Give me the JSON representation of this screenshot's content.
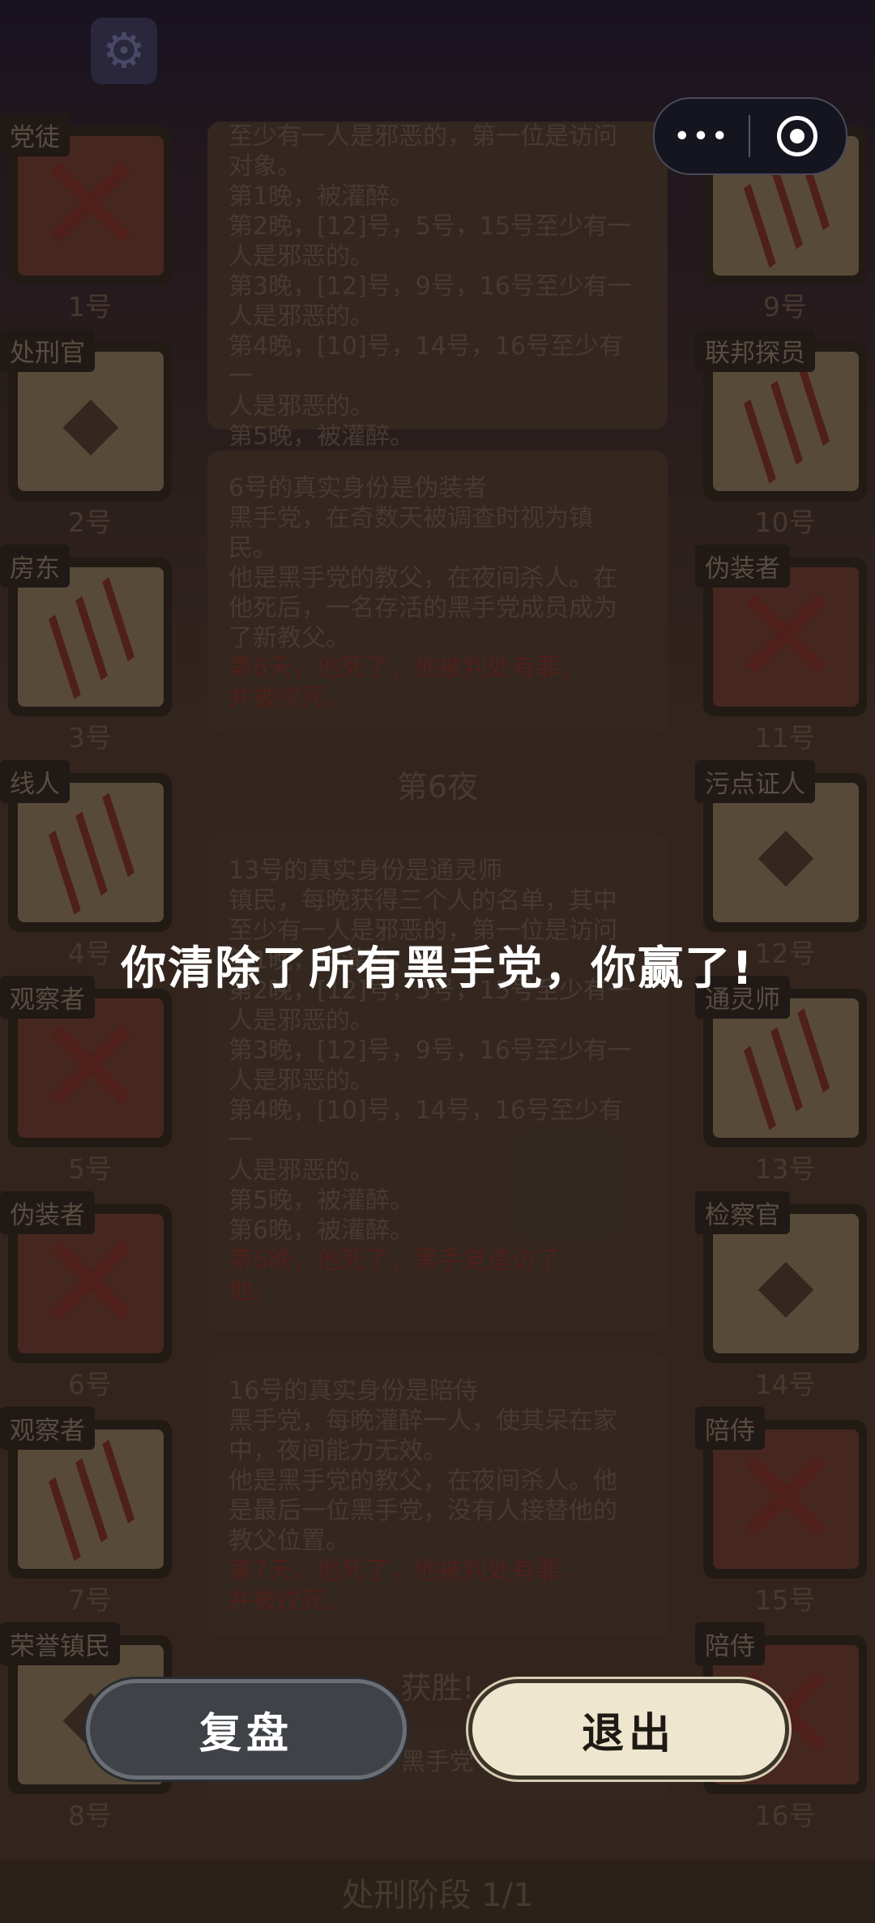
{
  "settings_icon": "gear-icon",
  "capsule": {
    "more_label": "•••",
    "close_icon": "record-circle-icon"
  },
  "left_players": [
    {
      "role": "党徒",
      "number": "1号",
      "status": "eliminated"
    },
    {
      "role": "处刑官",
      "number": "2号",
      "status": "alive"
    },
    {
      "role": "房东",
      "number": "3号",
      "status": "killed"
    },
    {
      "role": "线人",
      "number": "4号",
      "status": "killed"
    },
    {
      "role": "观察者",
      "number": "5号",
      "status": "eliminated"
    },
    {
      "role": "伪装者",
      "number": "6号",
      "status": "eliminated"
    },
    {
      "role": "观察者",
      "number": "7号",
      "status": "killed"
    },
    {
      "role": "荣誉镇民",
      "number": "8号",
      "status": "alive"
    }
  ],
  "right_players": [
    {
      "role": "统计员",
      "number": "9号",
      "status": "killed"
    },
    {
      "role": "联邦探员",
      "number": "10号",
      "status": "killed"
    },
    {
      "role": "伪装者",
      "number": "11号",
      "status": "eliminated"
    },
    {
      "role": "污点证人",
      "number": "12号",
      "status": "alive"
    },
    {
      "role": "通灵师",
      "number": "13号",
      "status": "killed"
    },
    {
      "role": "检察官",
      "number": "14号",
      "status": "alive"
    },
    {
      "role": "陪侍",
      "number": "15号",
      "status": "eliminated"
    },
    {
      "role": "陪侍",
      "number": "16号",
      "status": "eliminated"
    }
  ],
  "log": {
    "panel1": "至少有一人是邪恶的，第一位是访问\n对象。\n第1晚，被灌醉。\n第2晚，[12]号，5号，15号至少有一\n人是邪恶的。\n第3晚，[12]号，9号，16号至少有一\n人是邪恶的。\n第4晚，[10]号，14号，16号至少有一\n人是邪恶的。\n第5晚，被灌醉。",
    "panel2_text": "6号的真实身份是伪装者\n黑手党，在奇数天被调查时视为镇\n民。\n他是黑手党的教父，在夜间杀人。在\n他死后，一名存活的黑手党成员成为\n了新教父。",
    "panel2_red": "第6天，他死了，他被判处有罪，\n并被绞死。",
    "night_label": "第6夜",
    "panel3_text": "13号的真实身份是通灵师\n镇民，每晚获得三个人的名单，其中\n至少有一人是邪恶的，第一位是访问\n第1晚，被灌醉。\n第2晚，[12]号，5号，15号至少有一\n人是邪恶的。\n第3晚，[12]号，9号，16号至少有一\n人是邪恶的。\n第4晚，[10]号，14号，16号至少有一\n人是邪恶的。\n第5晚，被灌醉。\n第6晚，被灌醉。",
    "panel3_red": "第6晚，他死了，黑手党造访了\n他。",
    "panel4_text": "16号的真实身份是陪侍\n黑手党，每晚灌醉一人，使其呆在家\n中，夜间能力无效。\n他是黑手党的教父，在夜间杀人。他\n是最后一位黑手党，没有人接替他的\n教父位置。",
    "panel4_red": "第7天，他死了，他被判处有罪，\n并被绞死。",
    "victory": "获胜!",
    "panel5_text": "黑手党"
  },
  "stage_bar": "处刑阶段 1/1",
  "message": "你清除了所有黑手党，你赢了!",
  "buttons": {
    "replay": "复盘",
    "exit": "退出"
  },
  "colors": {
    "dead_red": "#7a2b24",
    "exit_bg": "#efe6cf",
    "replay_bg": "#3f4247"
  }
}
